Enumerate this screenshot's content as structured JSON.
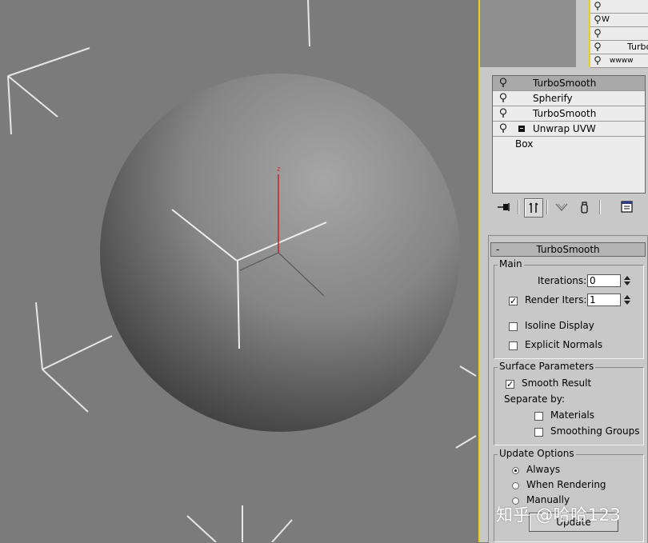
{
  "viewport": {
    "axis_label": "z"
  },
  "mini_list": {
    "items": [
      {
        "label": ""
      },
      {
        "label": "W"
      },
      {
        "label": ""
      },
      {
        "label": "Turbo"
      },
      {
        "label": "wwww"
      }
    ]
  },
  "modifier_stack": {
    "items": [
      {
        "label": "TurboSmooth",
        "selected": true
      },
      {
        "label": "Spherify",
        "selected": false
      },
      {
        "label": "TurboSmooth",
        "selected": false
      },
      {
        "label": "Unwrap UVW",
        "selected": false
      }
    ],
    "base": "Box"
  },
  "toolbar": {
    "icons": [
      "pin-stack-icon",
      "show-end-result-icon",
      "make-unique-icon",
      "remove-modifier-icon",
      "configure-modifier-sets-icon"
    ]
  },
  "rollout": {
    "title": "TurboSmooth",
    "collapse_symbol": "-",
    "main": {
      "title": "Main",
      "iterations_label": "Iterations:",
      "iterations_value": "0",
      "render_iters_label": "Render Iters:",
      "render_iters_value": "1",
      "render_iters_checked": true,
      "isoline_label": "Isoline Display",
      "isoline_checked": false,
      "explicit_normals_label": "Explicit Normals",
      "explicit_normals_checked": false
    },
    "surface": {
      "title": "Surface Parameters",
      "smooth_result_label": "Smooth Result",
      "smooth_result_checked": true,
      "separate_by_label": "Separate by:",
      "materials_label": "Materials",
      "materials_checked": false,
      "smoothing_groups_label": "Smoothing Groups",
      "smoothing_groups_checked": false
    },
    "update": {
      "title": "Update Options",
      "always_label": "Always",
      "when_rendering_label": "When Rendering",
      "manually_label": "Manually",
      "selected": "Always",
      "button_label": "Update"
    }
  },
  "watermark": "知乎 @哈哈123",
  "colors": {
    "accent_border": "#e8d020",
    "z_axis": "#d33"
  }
}
